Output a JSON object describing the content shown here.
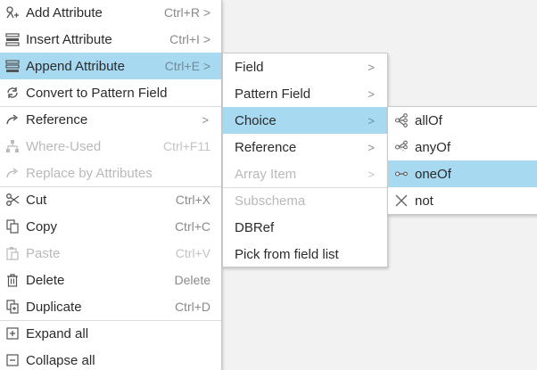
{
  "main_menu": {
    "items": [
      {
        "label": "Add Attribute",
        "shortcut": "Ctrl+R >",
        "icon": "add-attribute-icon"
      },
      {
        "label": "Insert Attribute",
        "shortcut": "Ctrl+I >",
        "icon": "insert-attribute-icon"
      },
      {
        "label": "Append Attribute",
        "shortcut": "Ctrl+E >",
        "icon": "append-attribute-icon"
      },
      {
        "label": "Convert to Pattern Field",
        "icon": "convert-icon"
      },
      {
        "label": "Reference",
        "arrow": ">",
        "icon": "reference-arrow-icon"
      },
      {
        "label": "Where-Used",
        "shortcut": "Ctrl+F11",
        "icon": "where-used-icon"
      },
      {
        "label": "Replace by Attributes",
        "icon": "replace-arrow-icon"
      },
      {
        "label": "Cut",
        "shortcut": "Ctrl+X",
        "icon": "scissors-icon"
      },
      {
        "label": "Copy",
        "shortcut": "Ctrl+C",
        "icon": "copy-icon"
      },
      {
        "label": "Paste",
        "shortcut": "Ctrl+V",
        "icon": "clipboard-icon"
      },
      {
        "label": "Delete",
        "shortcut": "Delete",
        "icon": "trash-icon"
      },
      {
        "label": "Duplicate",
        "shortcut": "Ctrl+D",
        "icon": "duplicate-icon"
      },
      {
        "label": "Expand all",
        "icon": "plus-box-icon"
      },
      {
        "label": "Collapse all",
        "icon": "minus-box-icon"
      }
    ]
  },
  "append_submenu": {
    "items": [
      {
        "label": "Field",
        "arrow": ">"
      },
      {
        "label": "Pattern Field",
        "arrow": ">"
      },
      {
        "label": "Choice",
        "arrow": ">"
      },
      {
        "label": "Reference",
        "arrow": ">"
      },
      {
        "label": "Array Item",
        "arrow": ">"
      },
      {
        "label": "Subschema"
      },
      {
        "label": "DBRef"
      },
      {
        "label": "Pick from field list"
      }
    ]
  },
  "choice_submenu": {
    "items": [
      {
        "label": "allOf",
        "icon": "allof-icon"
      },
      {
        "label": "anyOf",
        "icon": "anyof-icon"
      },
      {
        "label": "oneOf",
        "icon": "oneof-icon"
      },
      {
        "label": "not",
        "icon": "not-icon"
      }
    ]
  },
  "colors": {
    "selection": "#a7d9f1",
    "menu_background": "#ffffff",
    "disabled_text": "#b9b9b9",
    "canvas": "#f2f2f2"
  }
}
